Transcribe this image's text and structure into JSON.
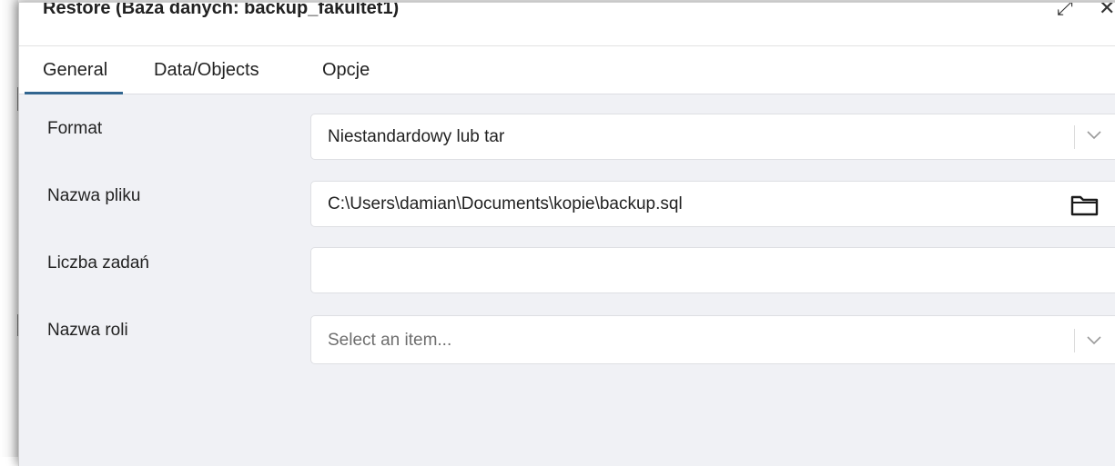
{
  "dialog": {
    "title": "Restore (Baza danych: backup_fakultet1)",
    "expand_icon": "expand-icon",
    "close_icon": "close-icon"
  },
  "tabs": [
    {
      "label": "General",
      "active": true
    },
    {
      "label": "Data/Objects",
      "active": false
    },
    {
      "label": "Opcje",
      "active": false
    }
  ],
  "form": {
    "format": {
      "label": "Format",
      "value": "Niestandardowy lub tar"
    },
    "filename": {
      "label": "Nazwa pliku",
      "value": "C:\\Users\\damian\\Documents\\kopie\\backup.sql",
      "icon": "folder-icon"
    },
    "jobs": {
      "label": "Liczba zadań",
      "value": ""
    },
    "role": {
      "label": "Nazwa roli",
      "placeholder": "Select an item..."
    }
  },
  "colors": {
    "accent": "#326690",
    "content_bg": "#f0f1f5"
  }
}
